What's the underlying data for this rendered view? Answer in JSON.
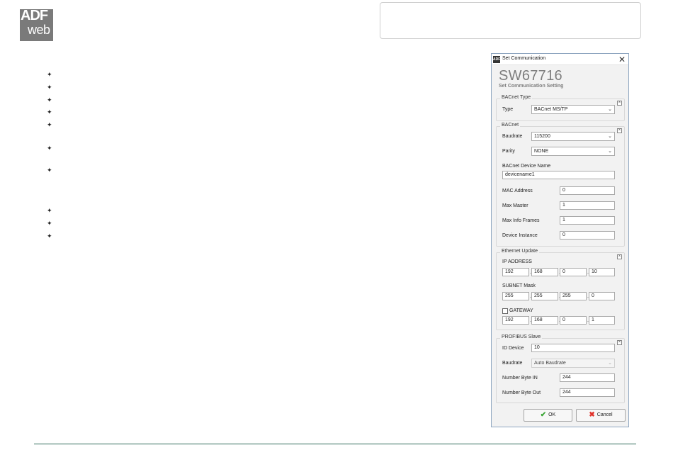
{
  "logo": {
    "line1": "ADF",
    "line2": "web"
  },
  "dialog": {
    "window_title": "Set Communication",
    "app_icon": "ADF",
    "heading": "SW67716",
    "subheading": "Set Communication Setting",
    "bacnet_type": {
      "title": "BACnet Type",
      "type_label": "Type",
      "type_value": "BACnet MS/TP"
    },
    "bacnet": {
      "title": "BACnet",
      "baudrate_label": "Baudrate",
      "baudrate_value": "115200",
      "parity_label": "Parity",
      "parity_value": "NONE",
      "device_name_label": "BACnet Device Name",
      "device_name_value": "devicename1",
      "mac_label": "MAC Address",
      "mac_value": "0",
      "max_master_label": "Max Master",
      "max_master_value": "1",
      "max_info_label": "Max Info Frames",
      "max_info_value": "1",
      "device_instance_label": "Device Instance",
      "device_instance_value": "0"
    },
    "ethernet": {
      "title": "Ethernet Update",
      "ip_label": "IP ADDRESS",
      "ip": [
        "192",
        "168",
        "0",
        "10"
      ],
      "subnet_label": "SUBNET Mask",
      "subnet": [
        "255",
        "255",
        "255",
        "0"
      ],
      "gateway_label": "GATEWAY",
      "gateway_checked": false,
      "gateway": [
        "192",
        "168",
        "0",
        "1"
      ]
    },
    "profibus": {
      "title": "PROFIBUS Slave",
      "id_label": "ID Device",
      "id_value": "10",
      "baudrate_label": "Baudrate",
      "baudrate_value": "Auto Baudrate",
      "byte_in_label": "Number Byte IN",
      "byte_in_value": "244",
      "byte_out_label": "Number Byte Out",
      "byte_out_value": "244"
    },
    "ok_label": "OK",
    "cancel_label": "Cancel"
  },
  "colors": {
    "footer_line": "#2f6b5a",
    "logo_bg": "#7a7a7a",
    "ok_icon": "#3aa535",
    "cancel_icon": "#e0322a"
  }
}
